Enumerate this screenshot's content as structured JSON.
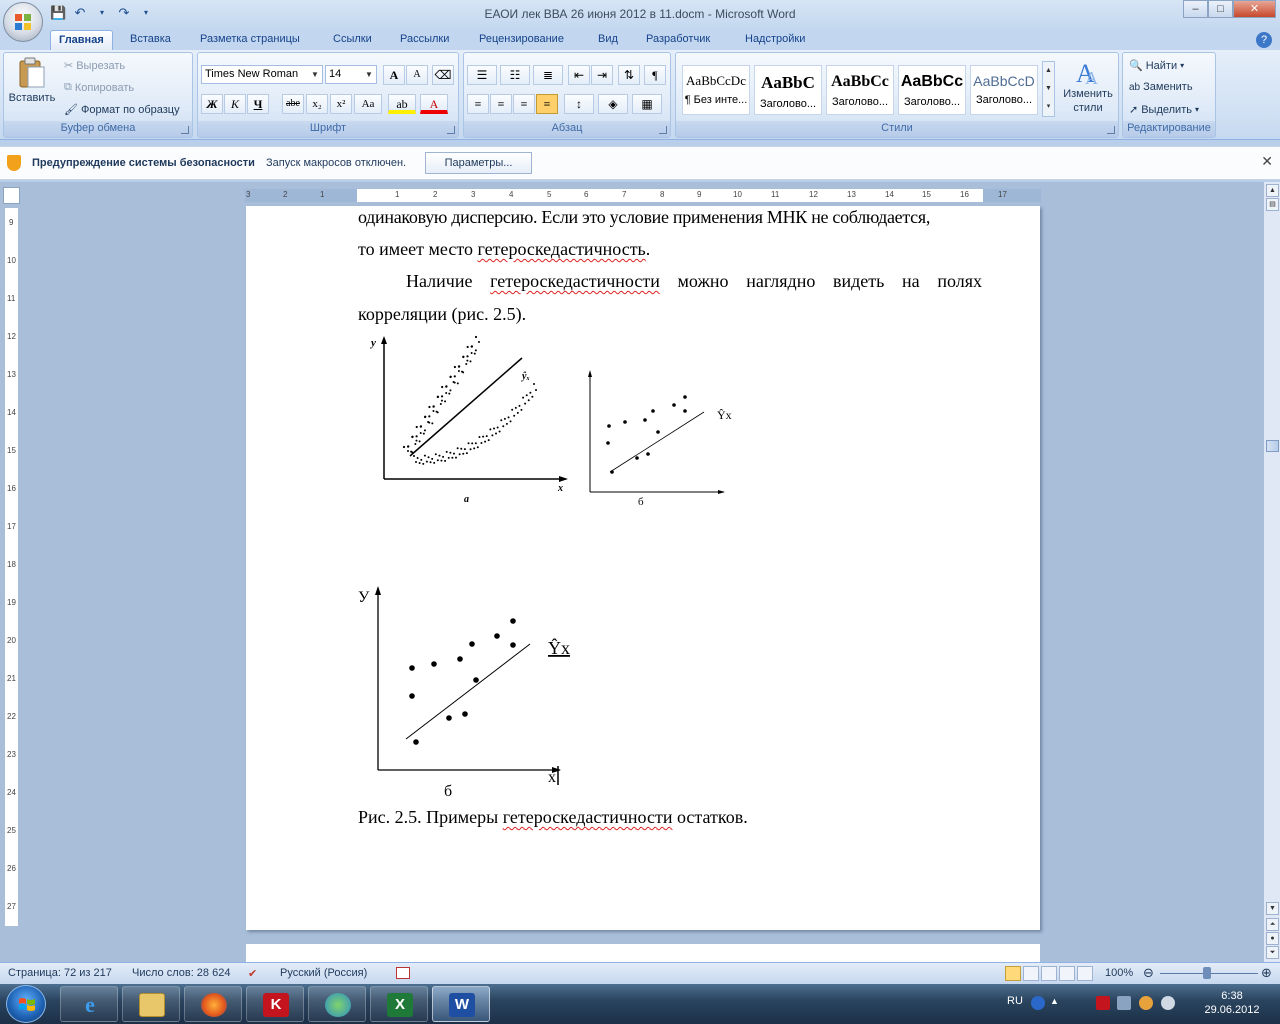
{
  "window": {
    "title": "ЕАОИ лек ВВА 26 июня 2012 в 11.docm - Microsoft Word",
    "minimize": "–",
    "maximize": "□",
    "close": "✕"
  },
  "ribbon_tabs": [
    "Главная",
    "Вставка",
    "Разметка страницы",
    "Ссылки",
    "Рассылки",
    "Рецензирование",
    "Вид",
    "Разработчик",
    "Надстройки"
  ],
  "clipboard": {
    "paste": "Вставить",
    "cut": "Вырезать",
    "copy": "Копировать",
    "format_painter": "Формат по образцу",
    "label": "Буфер обмена"
  },
  "font": {
    "name": "Times New Roman",
    "size": "14",
    "label": "Шрифт",
    "bold": "Ж",
    "italic": "К",
    "underline": "Ч",
    "strike": "abe",
    "subscript": "x₂",
    "superscript": "x²",
    "change_case": "Aa",
    "grow": "A",
    "shrink": "A"
  },
  "paragraph": {
    "label": "Абзац",
    "pilcrow": "¶"
  },
  "styles": {
    "label": "Стили",
    "tiles": [
      {
        "sample": "AaBbCcDc",
        "name": "¶ Без инте..."
      },
      {
        "sample": "AaBbC",
        "name": "Заголово..."
      },
      {
        "sample": "AaBbCc",
        "name": "Заголово..."
      },
      {
        "sample": "AaBbCc",
        "name": "Заголово..."
      },
      {
        "sample": "AaBbCcD",
        "name": "Заголово..."
      }
    ],
    "change_line1": "Изменить",
    "change_line2": "стили"
  },
  "editing": {
    "label": "Редактирование",
    "find": "Найти",
    "replace": "Заменить",
    "select": "Выделить"
  },
  "security_bar": {
    "title": "Предупреждение системы безопасности",
    "message": "Запуск макросов отключен.",
    "button": "Параметры..."
  },
  "document": {
    "line1": "одинаковую дисперсию. Если это условие применения МНК не соблюдается,",
    "line2_pre": "то имеет место ",
    "line2_wavy": "гетероскедастичность",
    "line2_post": ".",
    "para2_pre": "Наличие ",
    "para2_wavy": "гетероскедастичности",
    "para2_post": " можно наглядно видеть на полях",
    "para2_line2": "корреляции (рис. 2.5).",
    "fig_a_ylabel": "y",
    "fig_a_xlabel": "x",
    "fig_a_linelabel": "ŷₓ",
    "fig_a_caption": "a",
    "fig_b_linelabel": "Ŷx",
    "fig_b_caption": "б",
    "fig_c_ylabel": "У",
    "fig_c_xlabel": "x",
    "fig_c_linelabel": "Ŷx",
    "fig_c_caption": "б",
    "caption_pre": "Рис. 2.5. Примеры ",
    "caption_wavy": "гетероскедастичности",
    "caption_post": " остатков."
  },
  "statusbar": {
    "page": "Страница: 72 из 217",
    "words": "Число слов: 28 624",
    "language": "Русский (Россия)",
    "zoom": "100%",
    "zoom_level_percent": 100
  },
  "taskbar": {
    "items": [
      "internet-explorer",
      "file-explorer",
      "firefox",
      "kaspersky",
      "messenger",
      "excel",
      "word"
    ],
    "active_item": "word",
    "lang": "RU",
    "time": "6:38",
    "date": "29.06.2012"
  },
  "colors": {
    "ribbon": "#d1e1f4",
    "workspace": "#a9bfd9",
    "accent": "#15428b",
    "spell_underline": "#dd2222"
  }
}
